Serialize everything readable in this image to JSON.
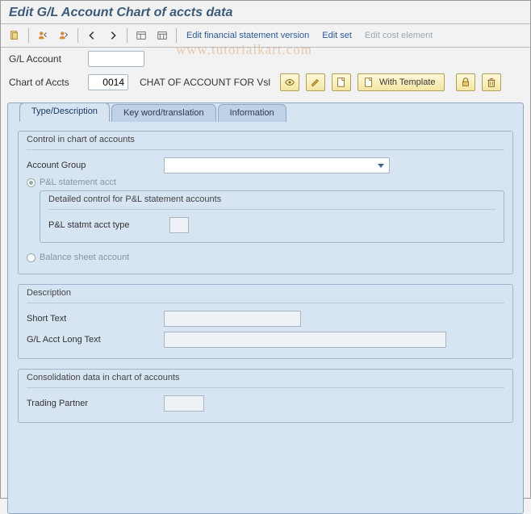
{
  "title": "Edit G/L Account Chart of accts data",
  "toolbar_links": {
    "edit_fsv": "Edit financial statement version",
    "edit_set": "Edit set",
    "edit_cost_elem": "Edit cost element"
  },
  "header": {
    "gl_account_label": "G/L Account",
    "gl_account_value": "",
    "chart_of_accts_label": "Chart of Accts",
    "chart_of_accts_value": "0014",
    "chart_of_accts_desc": "CHAT OF ACCOUNT FOR Vsl",
    "with_template_label": "With Template"
  },
  "tabs": {
    "type_desc": "Type/Description",
    "key_word": "Key word/translation",
    "information": "Information"
  },
  "group_control": {
    "title": "Control in chart of accounts",
    "account_group_label": "Account Group",
    "account_group_value": "",
    "pl_stmt_radio": "P&L statement acct",
    "detail_title": "Detailed control for P&L statement accounts",
    "pl_type_label": "P&L statmt acct type",
    "pl_type_value": "",
    "balance_radio": "Balance sheet account"
  },
  "group_desc": {
    "title": "Description",
    "short_text_label": "Short Text",
    "short_text_value": "",
    "long_text_label": "G/L Acct Long Text",
    "long_text_value": ""
  },
  "group_consol": {
    "title": "Consolidation data in chart of accounts",
    "trading_partner_label": "Trading Partner",
    "trading_partner_value": ""
  },
  "watermark": "www.tutorialkart.com"
}
